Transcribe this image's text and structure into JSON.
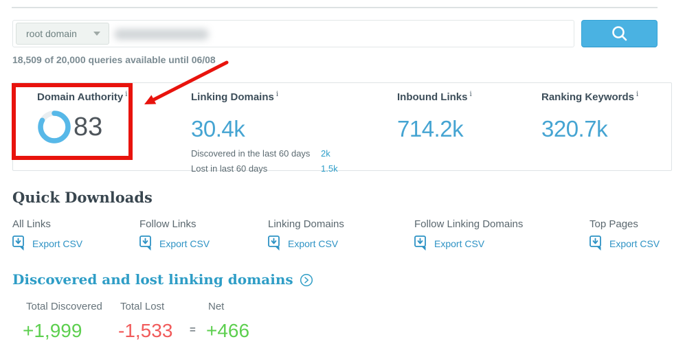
{
  "icons": {
    "info": "i"
  },
  "search": {
    "scope_selected": "root domain"
  },
  "quota_text": "18,509 of 20,000 queries available until 06/08",
  "metrics": [
    {
      "label": "Domain Authority",
      "value": "83",
      "gauge_percent": 83
    },
    {
      "label": "Linking Domains",
      "value": "30.4k",
      "sub": [
        {
          "label": "Discovered in the last 60 days",
          "value": "2k"
        },
        {
          "label": "Lost in last 60 days",
          "value": "1.5k"
        }
      ]
    },
    {
      "label": "Inbound Links",
      "value": "714.2k"
    },
    {
      "label": "Ranking Keywords",
      "value": "320.7k"
    }
  ],
  "quick_downloads": {
    "title": "Quick Downloads",
    "export_label": "Export CSV",
    "items": [
      {
        "label": "All Links"
      },
      {
        "label": "Follow Links"
      },
      {
        "label": "Linking Domains"
      },
      {
        "label": "Follow Linking Domains"
      },
      {
        "label": "Top Pages"
      }
    ]
  },
  "discovered_lost": {
    "title": "Discovered and lost linking domains",
    "equals": "=",
    "stats": [
      {
        "label": "Total Discovered",
        "value": "+1,999"
      },
      {
        "label": "Total Lost",
        "value": "-1,533"
      },
      {
        "label": "Net",
        "value": "+466"
      }
    ]
  },
  "colors": {
    "accent_blue": "#45a4d2",
    "link_blue": "#2d92c4",
    "button_blue": "#4ab2e2",
    "heading_teal": "#2e9dc6",
    "positive_green": "#5dcf4f",
    "negative_red": "#f15b5b",
    "annotation_red": "#e8130d",
    "gauge_blue": "#57b8e8"
  }
}
